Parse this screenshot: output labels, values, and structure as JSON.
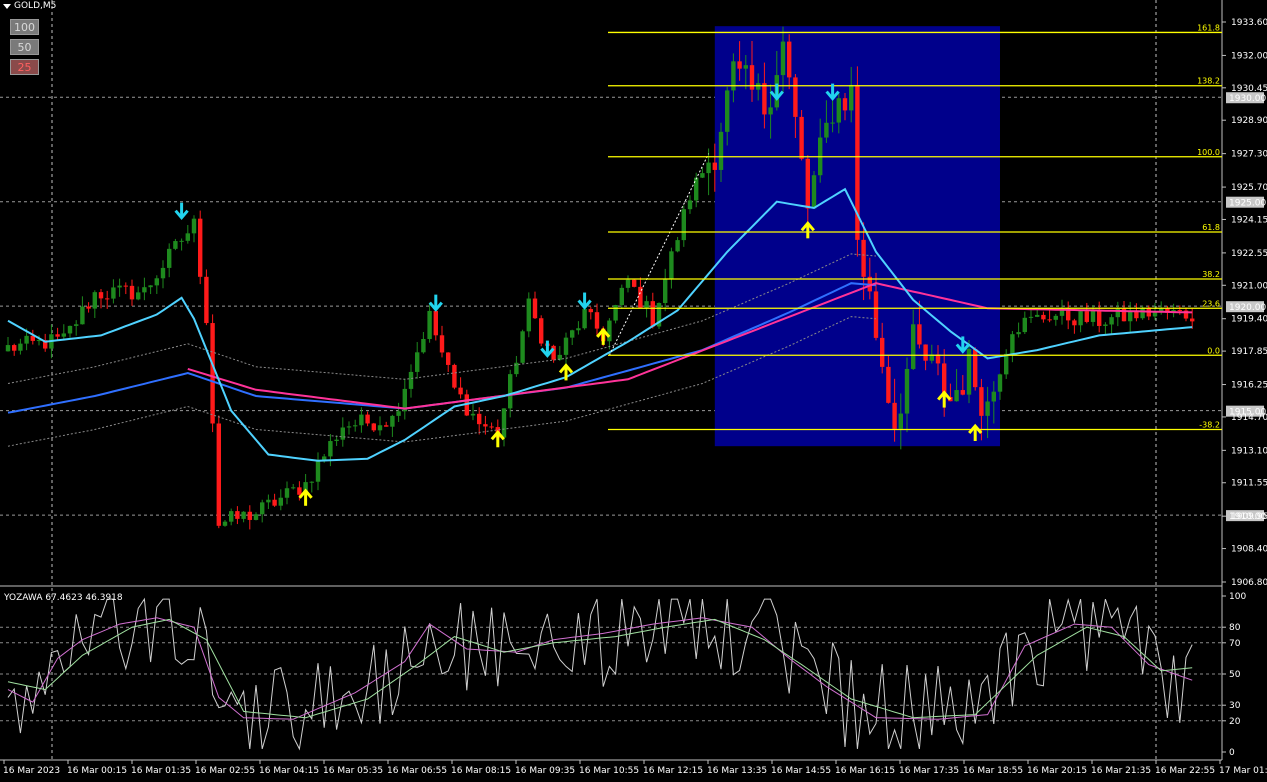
{
  "symbol": "GOLD,M5",
  "timeframe_buttons": [
    {
      "label": "100",
      "active": false
    },
    {
      "label": "50",
      "active": false
    },
    {
      "label": "25",
      "active": true
    }
  ],
  "oscillator_label": "YOZAWA 67.4623 46.3918",
  "colors": {
    "background": "#000000",
    "bull": "#1e8a1e",
    "bear": "#ff1a1a",
    "fib": "#ffff00",
    "zone": "#00008b",
    "ma_fast": "#4fd2ff",
    "ma_slow": "#2f6fff",
    "ma_pink": "#ff3399",
    "arrow_up": "#ffff00",
    "arrow_down": "#22d3ee"
  },
  "chart_data": [
    {
      "type": "candlestick",
      "title": "",
      "y_ticks": [
        "1933.60",
        "1932.00",
        "1930.45",
        "1928.90",
        "1927.30",
        "1925.70",
        "1924.15",
        "1922.55",
        "1921.00",
        "1919.40",
        "1917.85",
        "1916.25",
        "1914.70",
        "1913.10",
        "1911.55",
        "1909.95",
        "1908.40",
        "1906.80"
      ],
      "ylim": [
        1906.8,
        1933.6
      ],
      "price_labels": [
        "1930.00",
        "1925.00",
        "1920.00",
        "1915.00",
        "1910.00"
      ],
      "x_ticks": [
        "16 Mar 2023",
        "16 Mar 00:15",
        "16 Mar 01:35",
        "16 Mar 02:55",
        "16 Mar 04:15",
        "16 Mar 05:35",
        "16 Mar 06:55",
        "16 Mar 08:15",
        "16 Mar 09:35",
        "16 Mar 10:55",
        "16 Mar 12:15",
        "16 Mar 13:35",
        "16 Mar 14:55",
        "16 Mar 16:15",
        "16 Mar 17:35",
        "16 Mar 18:55",
        "16 Mar 20:15",
        "16 Mar 21:35",
        "16 Mar 22:55",
        "17 Mar 01:15"
      ],
      "fib_levels": [
        {
          "label": "161.8",
          "price": 1933.1
        },
        {
          "label": "138.2",
          "price": 1930.55
        },
        {
          "label": "100.0",
          "price": 1927.15
        },
        {
          "label": "61.8",
          "price": 1923.55
        },
        {
          "label": "38.2",
          "price": 1921.3
        },
        {
          "label": "23.6",
          "price": 1919.9
        },
        {
          "label": "0.0",
          "price": 1917.65
        },
        {
          "label": "-38.2",
          "price": 1914.1
        }
      ],
      "zone": {
        "t_start": 114,
        "t_end": 160,
        "price_low": 1913.3,
        "price_high": 1933.4
      },
      "anchors": [
        {
          "t": 0,
          "p": 1918.0
        },
        {
          "t": 9,
          "p": 1918.4
        },
        {
          "t": 14,
          "p": 1920.6
        },
        {
          "t": 22,
          "p": 1920.7
        },
        {
          "t": 28,
          "p": 1923.2
        },
        {
          "t": 30,
          "p": 1923.9
        },
        {
          "t": 32,
          "p": 1919.5
        },
        {
          "t": 34,
          "p": 1909.6
        },
        {
          "t": 40,
          "p": 1910.1
        },
        {
          "t": 48,
          "p": 1911.5
        },
        {
          "t": 54,
          "p": 1914.3
        },
        {
          "t": 62,
          "p": 1914.6
        },
        {
          "t": 68,
          "p": 1919.5
        },
        {
          "t": 72,
          "p": 1916.0
        },
        {
          "t": 76,
          "p": 1914.4
        },
        {
          "t": 79,
          "p": 1913.9
        },
        {
          "t": 84,
          "p": 1920.0
        },
        {
          "t": 88,
          "p": 1917.3
        },
        {
          "t": 93,
          "p": 1919.6
        },
        {
          "t": 96,
          "p": 1918.6
        },
        {
          "t": 100,
          "p": 1921.2
        },
        {
          "t": 104,
          "p": 1919.4
        },
        {
          "t": 110,
          "p": 1925.3
        },
        {
          "t": 114,
          "p": 1927.6
        },
        {
          "t": 117,
          "p": 1931.0
        },
        {
          "t": 122,
          "p": 1929.6
        },
        {
          "t": 125,
          "p": 1932.6
        },
        {
          "t": 129,
          "p": 1924.7
        },
        {
          "t": 133,
          "p": 1929.6
        },
        {
          "t": 136,
          "p": 1930.2
        },
        {
          "t": 137,
          "p": 1923.3
        },
        {
          "t": 140,
          "p": 1918.8
        },
        {
          "t": 143,
          "p": 1914.5
        },
        {
          "t": 146,
          "p": 1918.1
        },
        {
          "t": 150,
          "p": 1916.6
        },
        {
          "t": 152,
          "p": 1915.5
        },
        {
          "t": 155,
          "p": 1917.1
        },
        {
          "t": 158,
          "p": 1915.2
        },
        {
          "t": 162,
          "p": 1919.0
        },
        {
          "t": 168,
          "p": 1919.6
        },
        {
          "t": 176,
          "p": 1919.3
        },
        {
          "t": 184,
          "p": 1919.7
        },
        {
          "t": 191,
          "p": 1919.6
        }
      ],
      "ma_fast": [
        {
          "t": 0,
          "p": 1919.3
        },
        {
          "t": 6,
          "p": 1918.3
        },
        {
          "t": 15,
          "p": 1918.6
        },
        {
          "t": 24,
          "p": 1919.6
        },
        {
          "t": 28,
          "p": 1920.4
        },
        {
          "t": 30,
          "p": 1919.4
        },
        {
          "t": 36,
          "p": 1915.0
        },
        {
          "t": 42,
          "p": 1912.9
        },
        {
          "t": 50,
          "p": 1912.6
        },
        {
          "t": 58,
          "p": 1912.7
        },
        {
          "t": 64,
          "p": 1913.6
        },
        {
          "t": 72,
          "p": 1915.2
        },
        {
          "t": 80,
          "p": 1915.7
        },
        {
          "t": 90,
          "p": 1916.6
        },
        {
          "t": 100,
          "p": 1918.3
        },
        {
          "t": 108,
          "p": 1919.8
        },
        {
          "t": 116,
          "p": 1922.6
        },
        {
          "t": 124,
          "p": 1925.0
        },
        {
          "t": 130,
          "p": 1924.7
        },
        {
          "t": 135,
          "p": 1925.6
        },
        {
          "t": 140,
          "p": 1922.6
        },
        {
          "t": 146,
          "p": 1920.3
        },
        {
          "t": 152,
          "p": 1918.8
        },
        {
          "t": 158,
          "p": 1917.5
        },
        {
          "t": 166,
          "p": 1917.9
        },
        {
          "t": 176,
          "p": 1918.6
        },
        {
          "t": 191,
          "p": 1919.0
        }
      ],
      "ma_slow": [
        {
          "t": 0,
          "p": 1914.9
        },
        {
          "t": 14,
          "p": 1915.7
        },
        {
          "t": 29,
          "p": 1916.8
        },
        {
          "t": 40,
          "p": 1915.7
        },
        {
          "t": 64,
          "p": 1915.1
        },
        {
          "t": 90,
          "p": 1916.1
        },
        {
          "t": 112,
          "p": 1917.9
        },
        {
          "t": 126,
          "p": 1919.7
        },
        {
          "t": 136,
          "p": 1921.1
        },
        {
          "t": 140,
          "p": 1921.0
        }
      ],
      "ma_pink": [
        {
          "t": 29,
          "p": 1917.0
        },
        {
          "t": 40,
          "p": 1916.0
        },
        {
          "t": 64,
          "p": 1915.1
        },
        {
          "t": 100,
          "p": 1916.5
        },
        {
          "t": 140,
          "p": 1921.1
        },
        {
          "t": 158,
          "p": 1919.9
        },
        {
          "t": 191,
          "p": 1919.7
        }
      ],
      "arrows": [
        {
          "t": 28,
          "dir": "down",
          "price": 1923.9
        },
        {
          "t": 48,
          "dir": "up",
          "price": 1911.5
        },
        {
          "t": 69,
          "dir": "down",
          "price": 1919.5
        },
        {
          "t": 79,
          "dir": "up",
          "price": 1914.3
        },
        {
          "t": 87,
          "dir": "down",
          "price": 1917.3
        },
        {
          "t": 90,
          "dir": "up",
          "price": 1917.5
        },
        {
          "t": 93,
          "dir": "down",
          "price": 1919.6
        },
        {
          "t": 96,
          "dir": "up",
          "price": 1919.2
        },
        {
          "t": 124,
          "dir": "down",
          "price": 1929.6
        },
        {
          "t": 129,
          "dir": "up",
          "price": 1924.3
        },
        {
          "t": 133,
          "dir": "down",
          "price": 1929.6
        },
        {
          "t": 151,
          "dir": "up",
          "price": 1916.2
        },
        {
          "t": 154,
          "dir": "down",
          "price": 1917.5
        },
        {
          "t": 156,
          "dir": "up",
          "price": 1914.6
        }
      ]
    },
    {
      "type": "line",
      "title": "",
      "y_ticks": [
        "100",
        "80",
        "70",
        "50",
        "30",
        "20",
        "0"
      ],
      "ylim": [
        0,
        100
      ],
      "line_a": [
        {
          "t": 0,
          "v": 40
        },
        {
          "t": 4,
          "v": 32
        },
        {
          "t": 8,
          "v": 60
        },
        {
          "t": 12,
          "v": 72
        },
        {
          "t": 18,
          "v": 82
        },
        {
          "t": 24,
          "v": 86
        },
        {
          "t": 30,
          "v": 80
        },
        {
          "t": 34,
          "v": 35
        },
        {
          "t": 38,
          "v": 22
        },
        {
          "t": 46,
          "v": 21
        },
        {
          "t": 56,
          "v": 38
        },
        {
          "t": 64,
          "v": 58
        },
        {
          "t": 68,
          "v": 82
        },
        {
          "t": 74,
          "v": 66
        },
        {
          "t": 82,
          "v": 64
        },
        {
          "t": 88,
          "v": 72
        },
        {
          "t": 96,
          "v": 76
        },
        {
          "t": 104,
          "v": 82
        },
        {
          "t": 112,
          "v": 86
        },
        {
          "t": 120,
          "v": 80
        },
        {
          "t": 126,
          "v": 60
        },
        {
          "t": 132,
          "v": 42
        },
        {
          "t": 140,
          "v": 22
        },
        {
          "t": 150,
          "v": 21
        },
        {
          "t": 158,
          "v": 24
        },
        {
          "t": 164,
          "v": 68
        },
        {
          "t": 172,
          "v": 82
        },
        {
          "t": 178,
          "v": 80
        },
        {
          "t": 184,
          "v": 56
        },
        {
          "t": 191,
          "v": 46
        }
      ],
      "line_b": [
        {
          "t": 0,
          "v": 45
        },
        {
          "t": 6,
          "v": 40
        },
        {
          "t": 12,
          "v": 62
        },
        {
          "t": 20,
          "v": 80
        },
        {
          "t": 26,
          "v": 85
        },
        {
          "t": 32,
          "v": 72
        },
        {
          "t": 38,
          "v": 26
        },
        {
          "t": 48,
          "v": 22
        },
        {
          "t": 58,
          "v": 34
        },
        {
          "t": 66,
          "v": 56
        },
        {
          "t": 72,
          "v": 74
        },
        {
          "t": 80,
          "v": 64
        },
        {
          "t": 88,
          "v": 70
        },
        {
          "t": 98,
          "v": 74
        },
        {
          "t": 106,
          "v": 80
        },
        {
          "t": 114,
          "v": 85
        },
        {
          "t": 122,
          "v": 72
        },
        {
          "t": 128,
          "v": 56
        },
        {
          "t": 136,
          "v": 34
        },
        {
          "t": 146,
          "v": 22
        },
        {
          "t": 156,
          "v": 24
        },
        {
          "t": 166,
          "v": 62
        },
        {
          "t": 174,
          "v": 80
        },
        {
          "t": 180,
          "v": 74
        },
        {
          "t": 186,
          "v": 52
        },
        {
          "t": 191,
          "v": 54
        }
      ],
      "line_fast_seed": 67
    }
  ]
}
